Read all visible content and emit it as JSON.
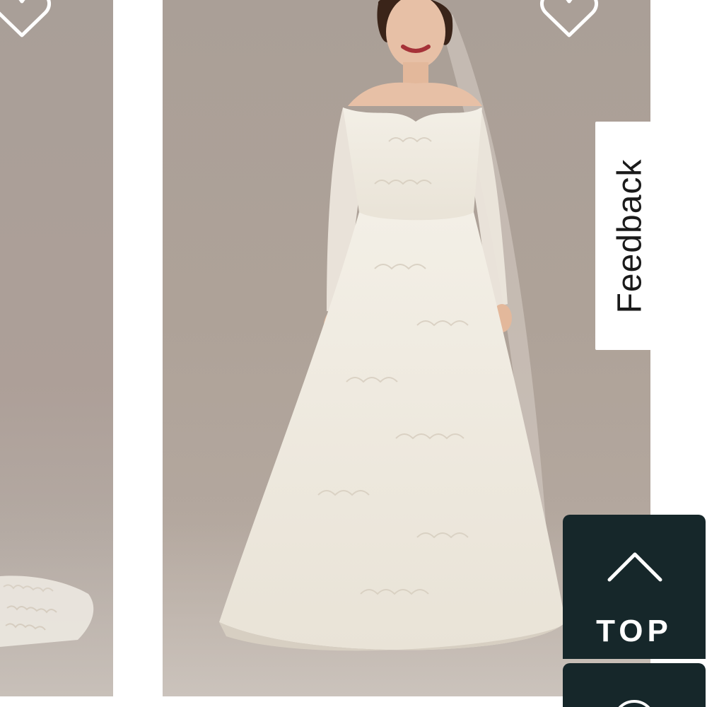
{
  "products": [
    {
      "id_label": "left-card",
      "wishlist_icon": "heart-outline-icon"
    },
    {
      "id_label": "main-card",
      "wishlist_icon": "heart-outline-icon"
    }
  ],
  "feedback": {
    "label": "Feedback"
  },
  "back_to_top": {
    "label": "TOP",
    "icon": "chevron-up-icon"
  },
  "colors": {
    "photo_background": "#aa9f97",
    "button_background": "#16272a",
    "button_text": "#ffffff",
    "page_background": "#ffffff"
  }
}
